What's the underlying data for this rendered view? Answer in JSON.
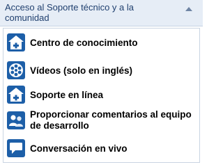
{
  "header": {
    "title": "Acceso al Soporte técnico y a la comunidad",
    "collapse_icon": "chevron-up-icon"
  },
  "items": [
    {
      "label": "Centro de conocimiento",
      "icon": "house-plus-icon"
    },
    {
      "label": "Vídeos (solo en inglés)",
      "icon": "film-reel-icon"
    },
    {
      "label": "Soporte en línea",
      "icon": "house-plus-icon"
    },
    {
      "label": "Proporcionar comentarios al equipo de desarrollo",
      "icon": "users-feedback-icon"
    },
    {
      "label": "Conversación en vivo",
      "icon": "chat-bubble-icon"
    }
  ],
  "colors": {
    "header_bg": "#e6edf6",
    "header_text": "#1f3f6e",
    "icon_blue": "#1d5fa8",
    "border": "#c9d4e2"
  }
}
